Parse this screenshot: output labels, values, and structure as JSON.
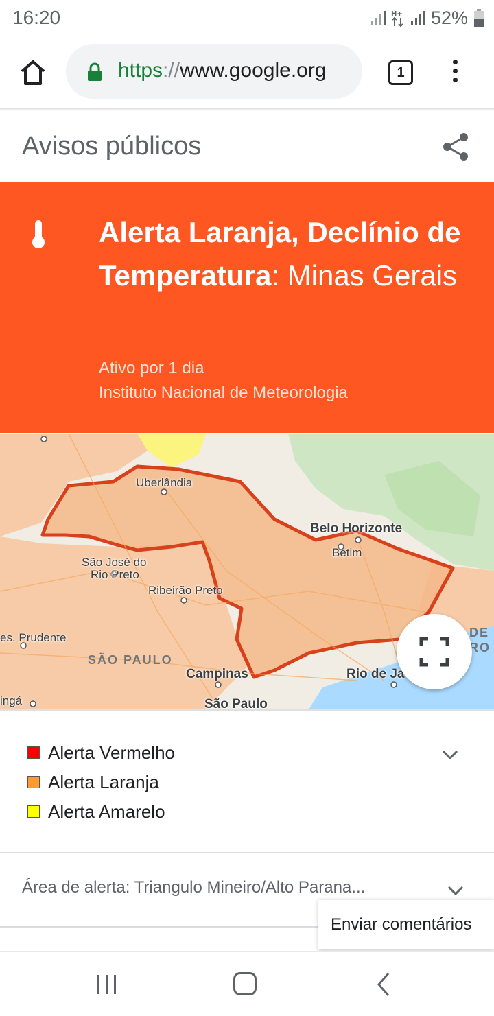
{
  "status_bar": {
    "time": "16:20",
    "battery": "52%"
  },
  "browser": {
    "url_scheme": "https",
    "url_sep": "://",
    "url_host": "www.google.org",
    "tab_count": "1"
  },
  "page": {
    "title": "Avisos públicos"
  },
  "alert": {
    "headline_bold": "Alerta Laranja, Declínio de Temperatura",
    "headline_rest": ": Minas Gerais",
    "active": "Ativo por 1 dia",
    "source": "Instituto Nacional de Meteorologia",
    "accent_color": "#ff5722"
  },
  "map": {
    "labels": {
      "uberlandia": "Uberlândia",
      "belo_horizonte": "Belo Horizonte",
      "betim": "Betim",
      "sao_jose_1": "São José do",
      "sao_jose_2": "Rio Preto",
      "ribeirao": "Ribeirão Preto",
      "prudente": "es. Prudente",
      "sao_paulo_state": "SÃO PAULO",
      "campinas": "Campinas",
      "rio": "Rio de Ja",
      "sao_paulo": "São Paulo",
      "inga": "ingá",
      "de": "DE",
      "ro": "RO"
    }
  },
  "legend": {
    "items": [
      {
        "label": "Alerta Vermelho",
        "color": "#ff0000"
      },
      {
        "label": "Alerta Laranja",
        "color": "#ff9933"
      },
      {
        "label": "Alerta Amarelo",
        "color": "#ffff00"
      }
    ]
  },
  "area": {
    "label": "Área de alerta: Triangulo Mineiro/Alto Parana..."
  },
  "feedback": {
    "label": "Enviar comentários"
  }
}
